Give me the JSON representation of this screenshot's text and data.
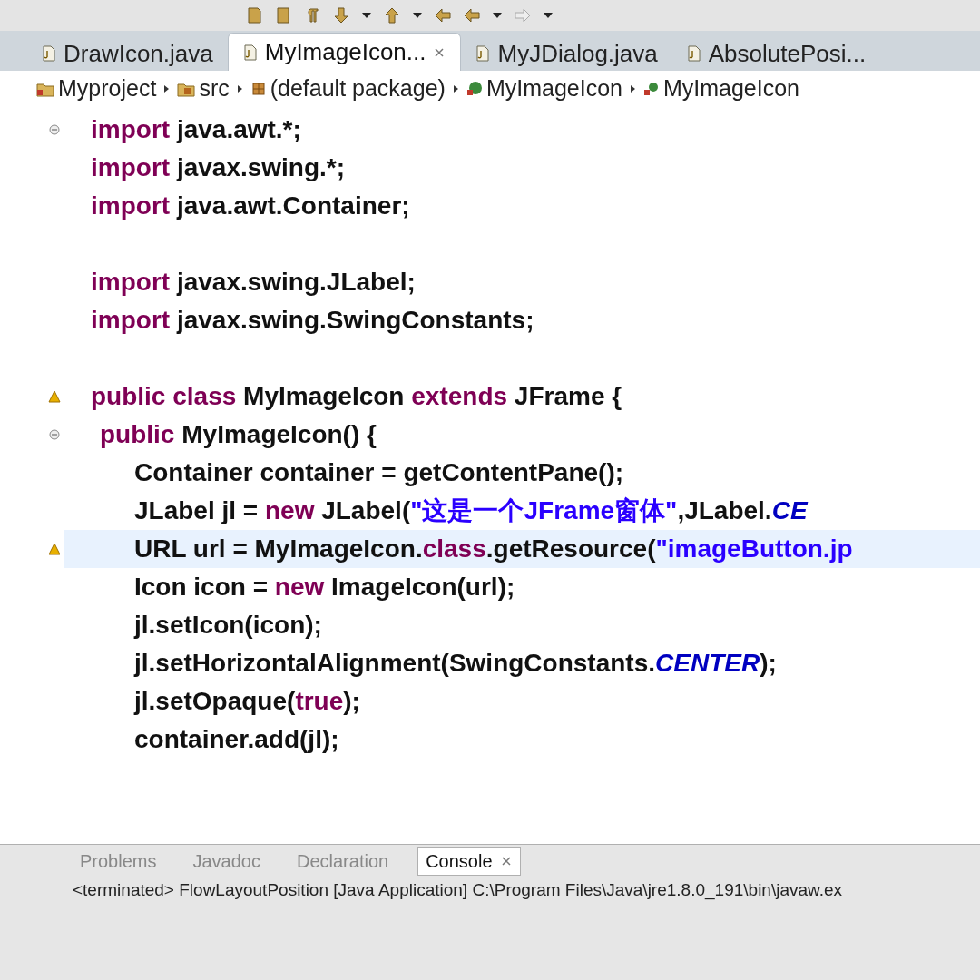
{
  "editor_tabs": [
    {
      "label": "DrawIcon.java",
      "selected": false,
      "closable": false
    },
    {
      "label": "MyImageIcon...",
      "selected": true,
      "closable": true
    },
    {
      "label": "MyJDialog.java",
      "selected": false,
      "closable": false
    },
    {
      "label": "AbsolutePosi...",
      "selected": false,
      "closable": false
    }
  ],
  "breadcrumb": [
    {
      "label": "Myproject",
      "kind": "project"
    },
    {
      "label": "src",
      "kind": "folder"
    },
    {
      "label": "(default package)",
      "kind": "package"
    },
    {
      "label": "MyImageIcon",
      "kind": "class"
    },
    {
      "label": "MyImageIcon",
      "kind": "method"
    }
  ],
  "code_lines": [
    {
      "kind": "code",
      "foldable": true,
      "warning": false,
      "highlighted": false,
      "tokens": [
        {
          "text": "import ",
          "kind": "keyword"
        },
        {
          "text": "java.awt.*;",
          "kind": "plain"
        }
      ]
    },
    {
      "kind": "code",
      "foldable": false,
      "warning": false,
      "highlighted": false,
      "tokens": [
        {
          "text": "import ",
          "kind": "keyword"
        },
        {
          "text": "javax.swing.*;",
          "kind": "plain"
        }
      ]
    },
    {
      "kind": "code",
      "foldable": false,
      "warning": false,
      "highlighted": false,
      "tokens": [
        {
          "text": "import ",
          "kind": "keyword"
        },
        {
          "text": "java.awt.Container;",
          "kind": "plain"
        }
      ]
    },
    {
      "kind": "blank"
    },
    {
      "kind": "code",
      "foldable": false,
      "warning": false,
      "highlighted": false,
      "tokens": [
        {
          "text": "import ",
          "kind": "keyword"
        },
        {
          "text": "javax.swing.JLabel;",
          "kind": "plain"
        }
      ]
    },
    {
      "kind": "code",
      "foldable": false,
      "warning": false,
      "highlighted": false,
      "tokens": [
        {
          "text": "import ",
          "kind": "keyword"
        },
        {
          "text": "javax.swing.SwingConstants;",
          "kind": "plain"
        }
      ]
    },
    {
      "kind": "blank"
    },
    {
      "kind": "code",
      "foldable": false,
      "warning": true,
      "highlighted": false,
      "tokens": [
        {
          "text": "public class ",
          "kind": "keyword"
        },
        {
          "text": "MyImageIcon ",
          "kind": "plain"
        },
        {
          "text": "extends ",
          "kind": "keyword"
        },
        {
          "text": "JFrame {",
          "kind": "plain"
        }
      ],
      "children": [
        {
          "kind": "code",
          "foldable": true,
          "warning": false,
          "highlighted": false,
          "tokens": [
            {
              "text": "public ",
              "kind": "keyword"
            },
            {
              "text": "MyImageIcon() {",
              "kind": "plain"
            }
          ],
          "children": [
            {
              "kind": "code",
              "foldable": false,
              "warning": false,
              "highlighted": false,
              "tokens": [
                {
                  "text": "Container container = getContentPane();",
                  "kind": "plain"
                }
              ]
            },
            {
              "kind": "code",
              "foldable": false,
              "warning": false,
              "highlighted": false,
              "tokens": [
                {
                  "text": "JLabel jl = ",
                  "kind": "plain"
                },
                {
                  "text": "new ",
                  "kind": "keyword"
                },
                {
                  "text": "JLabel(",
                  "kind": "plain"
                },
                {
                  "text": "\"这是一个JFrame窗体\"",
                  "kind": "string"
                },
                {
                  "text": ",JLabel.",
                  "kind": "plain"
                },
                {
                  "text": "CE",
                  "kind": "constant"
                }
              ]
            },
            {
              "kind": "code",
              "foldable": false,
              "warning": true,
              "highlighted": true,
              "tokens": [
                {
                  "text": "URL url = MyImageIcon.",
                  "kind": "plain"
                },
                {
                  "text": "class",
                  "kind": "keyword"
                },
                {
                  "text": ".getResource(",
                  "kind": "plain"
                },
                {
                  "text": "\"imageButton.jp",
                  "kind": "string"
                }
              ]
            },
            {
              "kind": "code",
              "foldable": false,
              "warning": false,
              "highlighted": false,
              "tokens": [
                {
                  "text": "Icon icon = ",
                  "kind": "plain"
                },
                {
                  "text": "new ",
                  "kind": "keyword"
                },
                {
                  "text": "ImageIcon(url);",
                  "kind": "plain"
                }
              ]
            },
            {
              "kind": "code",
              "foldable": false,
              "warning": false,
              "highlighted": false,
              "tokens": [
                {
                  "text": "jl.setIcon(icon);",
                  "kind": "plain"
                }
              ]
            },
            {
              "kind": "code",
              "foldable": false,
              "warning": false,
              "highlighted": false,
              "tokens": [
                {
                  "text": "jl.setHorizontalAlignment(SwingConstants.",
                  "kind": "plain"
                },
                {
                  "text": "CENTER",
                  "kind": "constant"
                },
                {
                  "text": ");",
                  "kind": "plain"
                }
              ]
            },
            {
              "kind": "code",
              "foldable": false,
              "warning": false,
              "highlighted": false,
              "tokens": [
                {
                  "text": "jl.setOpaque(",
                  "kind": "plain"
                },
                {
                  "text": "true",
                  "kind": "keyword"
                },
                {
                  "text": ");",
                  "kind": "plain"
                }
              ]
            },
            {
              "kind": "code",
              "foldable": false,
              "warning": false,
              "highlighted": false,
              "tokens": [
                {
                  "text": "container.add(jl);",
                  "kind": "plain"
                }
              ]
            }
          ]
        }
      ]
    }
  ],
  "bottom_tabs": [
    {
      "label": "Problems",
      "selected": false,
      "closable": false
    },
    {
      "label": "Javadoc",
      "selected": false,
      "closable": false
    },
    {
      "label": "Declaration",
      "selected": false,
      "closable": false
    },
    {
      "label": "Console",
      "selected": true,
      "closable": true
    }
  ],
  "console_line": "<terminated> FlowLayoutPosition [Java Application] C:\\Program Files\\Java\\jre1.8.0_191\\bin\\javaw.ex"
}
